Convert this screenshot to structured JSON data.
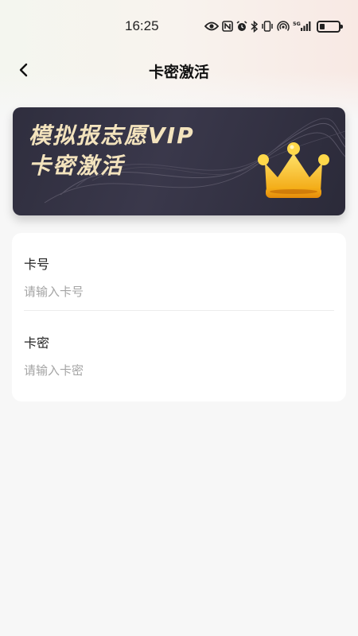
{
  "status_bar": {
    "time": "16:25",
    "network_label": "5G",
    "icons": [
      "eye-icon",
      "nfc-icon",
      "alarm-icon",
      "bluetooth-icon",
      "vibrate-icon",
      "hotspot-icon",
      "signal-icon",
      "battery-icon"
    ]
  },
  "nav": {
    "back_icon": "chevron-left-icon",
    "title": "卡密激活"
  },
  "banner": {
    "line1": "模拟报志愿VIP",
    "line2": "卡密激活",
    "icon": "crown-icon",
    "colors": {
      "background": "#33323f",
      "text": "#f3e3bd",
      "crown": "#f8c21d"
    }
  },
  "form": {
    "card_number": {
      "label": "卡号",
      "placeholder": "请输入卡号",
      "value": ""
    },
    "card_password": {
      "label": "卡密",
      "placeholder": "请输入卡密",
      "value": ""
    }
  }
}
